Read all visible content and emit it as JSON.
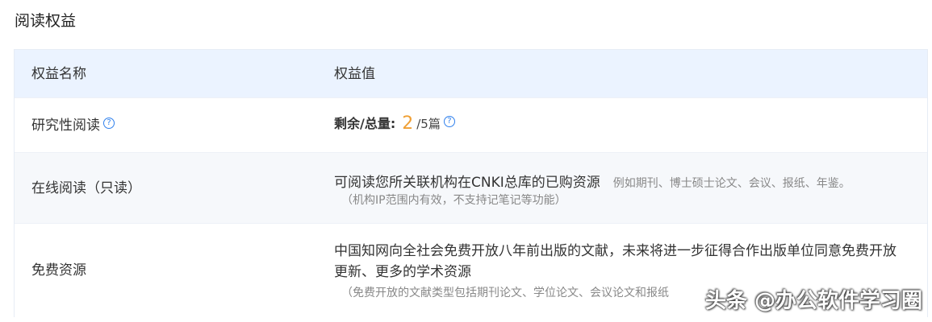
{
  "section": {
    "title": "阅读权益"
  },
  "table": {
    "header": {
      "name": "权益名称",
      "value": "权益值"
    },
    "rows": [
      {
        "name": "研究性阅读",
        "quota_label": "剩余/总量:",
        "quota_remaining": "2",
        "quota_total": "/5篇"
      },
      {
        "name": "在线阅读（只读）",
        "main_text": "可阅读您所关联机构在CNKI总库的已购资源",
        "example": "例如期刊、博士硕士论文、会议、报纸、年鉴。",
        "note": "（机构IP范围内有效，不支持记笔记等功能）"
      },
      {
        "name": "免费资源",
        "main_text": "中国知网向全社会免费开放八年前出版的文献，未来将进一步征得合作出版单位同意免费开放更新、更多的学术资源",
        "note": "（免费开放的文献类型包括期刊论文、学位论文、会议论文和报纸"
      }
    ]
  },
  "watermark": "头条 @办公软件学习圈",
  "icons": {
    "help": "help-question-icon",
    "help_glyph": "?"
  },
  "colors": {
    "header_bg": "#ebf3ff",
    "accent_orange": "#f0a035",
    "help_blue": "#2f80ed"
  }
}
